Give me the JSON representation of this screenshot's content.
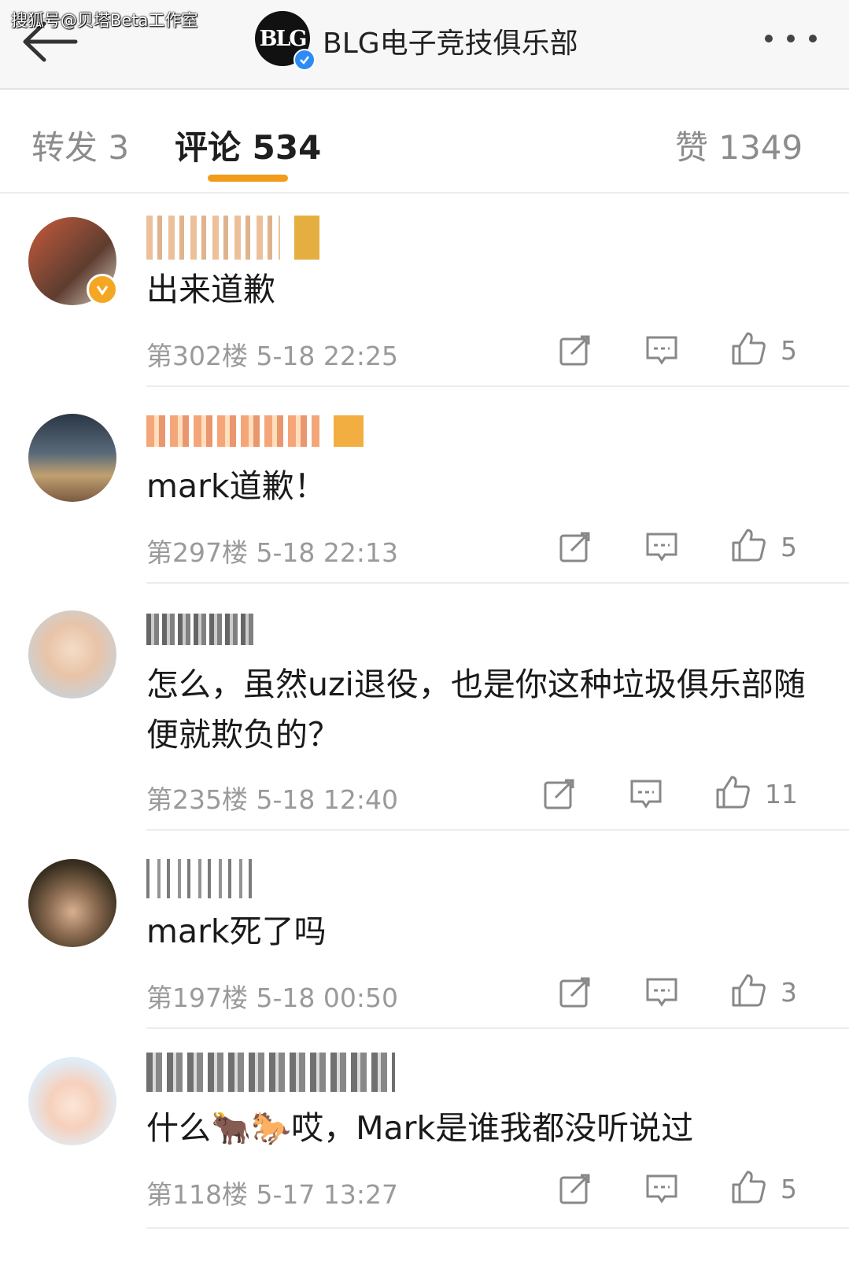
{
  "watermark": "搜狐号@贝塔Beta工作室",
  "header": {
    "logo_text": "BLG",
    "title": "BLG电子竞技俱乐部"
  },
  "tabs": [
    {
      "label": "转发 3"
    },
    {
      "label": "评论 534"
    },
    {
      "label": "赞 1349"
    }
  ],
  "comments": [
    {
      "name": "",
      "text": "出来道歉",
      "meta": "第302楼  5-18 22:25",
      "likes": "5"
    },
    {
      "name": "",
      "text": "mark道歉！",
      "meta": "第297楼  5-18 22:13",
      "likes": "5"
    },
    {
      "name": "",
      "text": "怎么，虽然uzi退役，也是你这种垃圾俱乐部随便就欺负的？",
      "meta": "第235楼  5-18 12:40",
      "likes": "11"
    },
    {
      "name": "",
      "text": "mark死了吗",
      "meta": "第197楼  5-18 00:50",
      "likes": "3"
    },
    {
      "name": "",
      "text": "什么🐂🐎哎，Mark是谁我都没听说过",
      "meta": "第118楼  5-17 13:27",
      "likes": "5"
    }
  ],
  "colors": {
    "accent": "#f19c1b",
    "verified_orange": "#f5a623",
    "verified_blue": "#2c8cf4",
    "meta_gray": "#9a9a9a"
  },
  "icons": [
    "back-arrow-icon",
    "more-icon",
    "repost-icon",
    "reply-icon",
    "like-icon",
    "verified-icon"
  ]
}
